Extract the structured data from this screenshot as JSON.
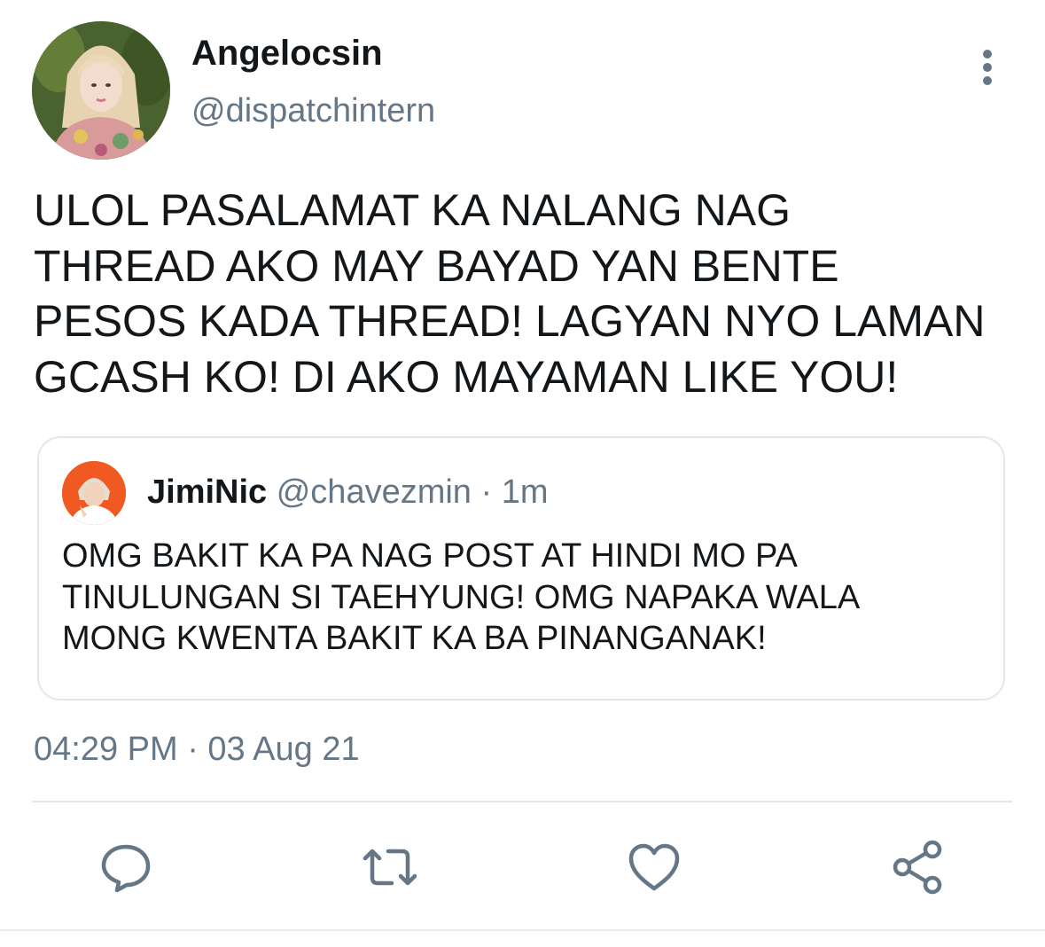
{
  "tweet": {
    "author": {
      "display_name": "Angelocsin",
      "handle": "@dispatchintern",
      "avatar_icon": "avatar-photo"
    },
    "text": "ULOL PASALAMAT KA NALANG NAG\nTHREAD AKO MAY BAYAD YAN BENTE\nPESOS KADA THREAD! LAGYAN NYO LAMAN\nGCASH KO! DI AKO MAYAMAN LIKE YOU!",
    "timestamp": "04:29 PM · 03 Aug 21",
    "more_icon": "more-vertical-icon"
  },
  "quoted_tweet": {
    "author": {
      "display_name": "JimiNic",
      "handle": "@chavezmin",
      "avatar_icon": "avatar-photo"
    },
    "separator": "·",
    "time": "1m",
    "text": "OMG BAKIT KA PA NAG POST AT HINDI MO PA\nTINULUNGAN SI TAEHYUNG! OMG NAPAKA WALA\nMONG KWENTA BAKIT KA BA PINANGANAK!"
  },
  "actions": [
    {
      "name": "reply",
      "icon": "reply-icon"
    },
    {
      "name": "retweet",
      "icon": "retweet-icon"
    },
    {
      "name": "like",
      "icon": "heart-icon"
    },
    {
      "name": "share",
      "icon": "share-icon"
    }
  ],
  "colors": {
    "primary_text": "#14171a",
    "secondary_text": "#657786",
    "border": "#e1e8ed"
  }
}
